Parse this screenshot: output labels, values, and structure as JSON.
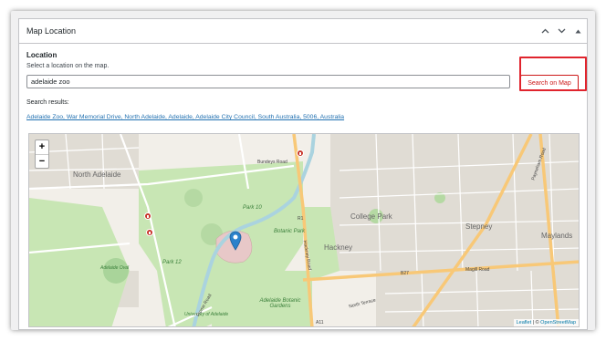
{
  "panel": {
    "title": "Map Location"
  },
  "field": {
    "label": "Location",
    "description": "Select a location on the map.",
    "input_value": "adelaide zoo",
    "button_label": "Search on Map"
  },
  "results": {
    "label": "Search results:",
    "items": [
      "Adelaide Zoo, War Memorial Drive, North Adelaide, Adelaide, Adelaide City Council, South Australia, 5006, Australia"
    ]
  },
  "map": {
    "zoom_in": "+",
    "zoom_out": "−",
    "attribution": {
      "leaflet": "Leaflet",
      "separator": " | © ",
      "osm": "OpenStreetMap"
    },
    "labels": {
      "north_adelaide": "North Adelaide",
      "college_park": "College Park",
      "hackney": "Hackney",
      "stepney": "Stepney",
      "maylands": "Maylands",
      "park_10": "Park 10",
      "botanic_park": "Botanic Park",
      "park_12": "Park 12",
      "botanic_gardens": "Adelaide Botanic Gardens",
      "adelaide_oval": "Adelaide Oval",
      "university": "University of Adelaide",
      "r1": "R1",
      "a11": "A11",
      "b27": "B27",
      "magill_road": "Magill Road",
      "north_terrace": "North Terrace",
      "frome_road": "Frome Road",
      "hackney_road": "Hackney Road",
      "bundeys_road": "Bundeys Road",
      "payneham_road": "Payneham Road"
    },
    "colors": {
      "land": "#f2efe9",
      "park": "#c8e6b4",
      "water": "#aad3df",
      "major_road": "#f8c877",
      "residential": "#e0dcd4",
      "marker": "#2a81cb",
      "highlight": "#e0242d"
    }
  }
}
